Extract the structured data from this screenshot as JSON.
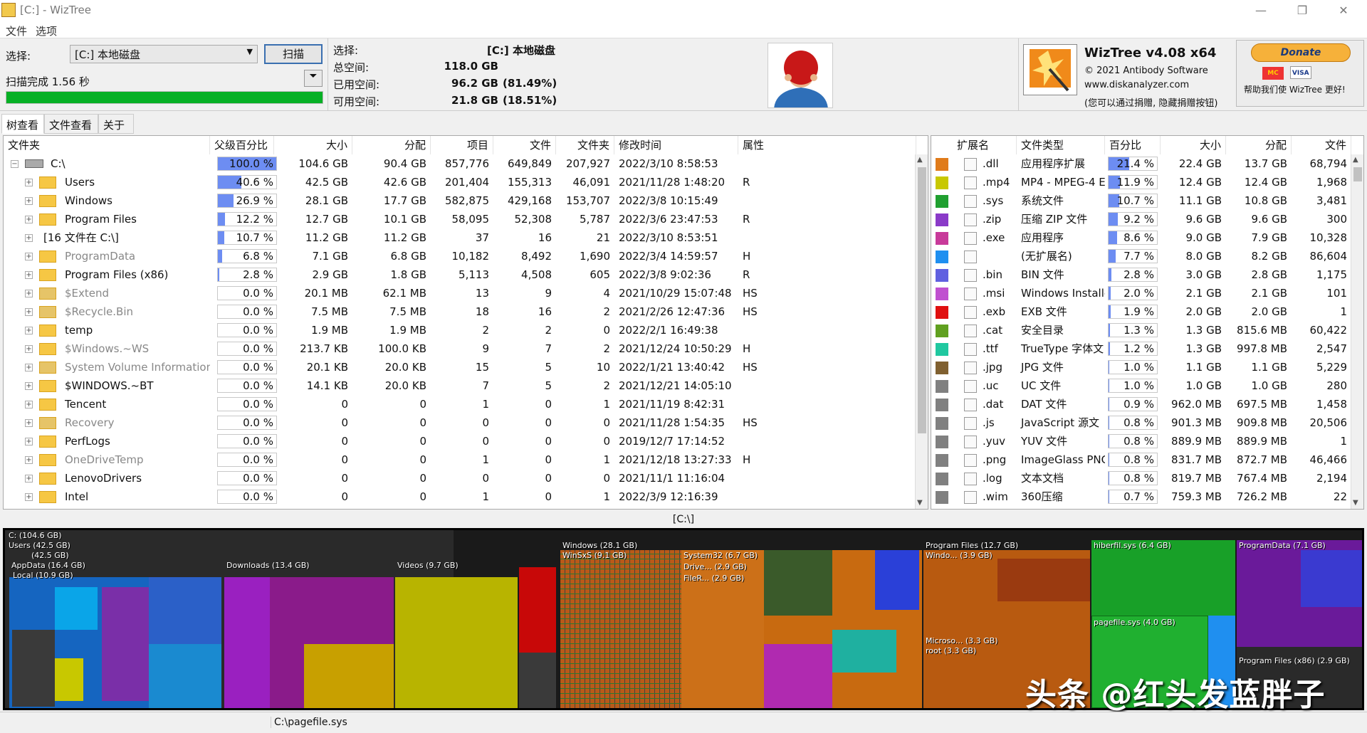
{
  "window": {
    "title": "[C:] - WizTree"
  },
  "menu": [
    "文件",
    "选项"
  ],
  "scan": {
    "select_label": "选择:",
    "drive": "[C:] 本地磁盘",
    "scan_button": "扫描",
    "status": "扫描完成 1.56 秒",
    "progress": 1.0
  },
  "info": {
    "select_label": "选择:",
    "select_value": "[C:]  本地磁盘",
    "total_label": "总空间:",
    "total_value": "118.0 GB",
    "used_label": "已用空间:",
    "used_value": "96.2 GB",
    "used_pct": "(81.49%)",
    "free_label": "可用空间:",
    "free_value": "21.8 GB",
    "free_pct": "(18.51%)"
  },
  "about": {
    "name": "WizTree v4.08 x64",
    "copyright": "© 2021 Antibody Software",
    "url": "www.diskanalyzer.com",
    "note": "(您可以通过捐赠, 隐藏捐赠按钮)"
  },
  "donate": {
    "button": "Donate",
    "card1": "MC",
    "card2": "VISA",
    "note": "帮助我们使 WizTree 更好!"
  },
  "tabs": [
    "树查看",
    "文件查看",
    "关于"
  ],
  "tree": {
    "columns": [
      "文件夹",
      "父级百分比",
      "大小",
      "分配",
      "项目",
      "文件",
      "文件夹",
      "修改时间",
      "属性"
    ],
    "rows": [
      {
        "name": "C:\\",
        "pct": 100.0,
        "pct_text": "100.0 %",
        "size": "104.6 GB",
        "alloc": "90.4 GB",
        "items": "857,776",
        "files": "649,849",
        "folders": "207,927",
        "modified": "2022/3/10 8:58:53",
        "attr": "",
        "kind": "drive"
      },
      {
        "name": "Users",
        "pct": 40.6,
        "pct_text": "40.6 %",
        "size": "42.5 GB",
        "alloc": "42.6 GB",
        "items": "201,404",
        "files": "155,313",
        "folders": "46,091",
        "modified": "2021/11/28 1:48:20",
        "attr": "R",
        "kind": "folder"
      },
      {
        "name": "Windows",
        "pct": 26.9,
        "pct_text": "26.9 %",
        "size": "28.1 GB",
        "alloc": "17.7 GB",
        "items": "582,875",
        "files": "429,168",
        "folders": "153,707",
        "modified": "2022/3/8 10:15:49",
        "attr": "",
        "kind": "folder"
      },
      {
        "name": "Program Files",
        "pct": 12.2,
        "pct_text": "12.2 %",
        "size": "12.7 GB",
        "alloc": "10.1 GB",
        "items": "58,095",
        "files": "52,308",
        "folders": "5,787",
        "modified": "2022/3/6 23:47:53",
        "attr": "R",
        "kind": "folder"
      },
      {
        "name": "[16 文件在 C:\\]",
        "pct": 10.7,
        "pct_text": "10.7 %",
        "size": "11.2 GB",
        "alloc": "11.2 GB",
        "items": "37",
        "files": "16",
        "folders": "21",
        "modified": "2022/3/10 8:53:51",
        "attr": "",
        "kind": "files"
      },
      {
        "name": "ProgramData",
        "pct": 6.8,
        "pct_text": "6.8 %",
        "size": "7.1 GB",
        "alloc": "6.8 GB",
        "items": "10,182",
        "files": "8,492",
        "folders": "1,690",
        "modified": "2022/3/4 14:59:57",
        "attr": "H",
        "kind": "hidden"
      },
      {
        "name": "Program Files (x86)",
        "pct": 2.8,
        "pct_text": "2.8 %",
        "size": "2.9 GB",
        "alloc": "1.8 GB",
        "items": "5,113",
        "files": "4,508",
        "folders": "605",
        "modified": "2022/3/8 9:02:36",
        "attr": "R",
        "kind": "folder"
      },
      {
        "name": "$Extend",
        "pct": 0.0,
        "pct_text": "0.0 %",
        "size": "20.1 MB",
        "alloc": "62.1 MB",
        "items": "13",
        "files": "9",
        "folders": "4",
        "modified": "2021/10/29 15:07:48",
        "attr": "HS",
        "kind": "system"
      },
      {
        "name": "$Recycle.Bin",
        "pct": 0.0,
        "pct_text": "0.0 %",
        "size": "7.5 MB",
        "alloc": "7.5 MB",
        "items": "18",
        "files": "16",
        "folders": "2",
        "modified": "2021/2/26 12:47:36",
        "attr": "HS",
        "kind": "system"
      },
      {
        "name": "temp",
        "pct": 0.0,
        "pct_text": "0.0 %",
        "size": "1.9 MB",
        "alloc": "1.9 MB",
        "items": "2",
        "files": "2",
        "folders": "0",
        "modified": "2022/2/1 16:49:38",
        "attr": "",
        "kind": "folder"
      },
      {
        "name": "$Windows.~WS",
        "pct": 0.0,
        "pct_text": "0.0 %",
        "size": "213.7 KB",
        "alloc": "100.0 KB",
        "items": "9",
        "files": "7",
        "folders": "2",
        "modified": "2021/12/24 10:50:29",
        "attr": "H",
        "kind": "hidden"
      },
      {
        "name": "System Volume Information",
        "pct": 0.0,
        "pct_text": "0.0 %",
        "size": "20.1 KB",
        "alloc": "20.0 KB",
        "items": "15",
        "files": "5",
        "folders": "10",
        "modified": "2022/1/21 13:40:42",
        "attr": "HS",
        "kind": "system"
      },
      {
        "name": "$WINDOWS.~BT",
        "pct": 0.0,
        "pct_text": "0.0 %",
        "size": "14.1 KB",
        "alloc": "20.0 KB",
        "items": "7",
        "files": "5",
        "folders": "2",
        "modified": "2021/12/21 14:05:10",
        "attr": "",
        "kind": "folder"
      },
      {
        "name": "Tencent",
        "pct": 0.0,
        "pct_text": "0.0 %",
        "size": "0",
        "alloc": "0",
        "items": "1",
        "files": "0",
        "folders": "1",
        "modified": "2021/11/19 8:42:31",
        "attr": "",
        "kind": "folder"
      },
      {
        "name": "Recovery",
        "pct": 0.0,
        "pct_text": "0.0 %",
        "size": "0",
        "alloc": "0",
        "items": "0",
        "files": "0",
        "folders": "0",
        "modified": "2021/11/28 1:54:35",
        "attr": "HS",
        "kind": "system"
      },
      {
        "name": "PerfLogs",
        "pct": 0.0,
        "pct_text": "0.0 %",
        "size": "0",
        "alloc": "0",
        "items": "0",
        "files": "0",
        "folders": "0",
        "modified": "2019/12/7 17:14:52",
        "attr": "",
        "kind": "folder"
      },
      {
        "name": "OneDriveTemp",
        "pct": 0.0,
        "pct_text": "0.0 %",
        "size": "0",
        "alloc": "0",
        "items": "1",
        "files": "0",
        "folders": "1",
        "modified": "2021/12/18 13:27:33",
        "attr": "H",
        "kind": "hidden"
      },
      {
        "name": "LenovoDrivers",
        "pct": 0.0,
        "pct_text": "0.0 %",
        "size": "0",
        "alloc": "0",
        "items": "0",
        "files": "0",
        "folders": "0",
        "modified": "2021/11/1 11:16:04",
        "attr": "",
        "kind": "folder"
      },
      {
        "name": "Intel",
        "pct": 0.0,
        "pct_text": "0.0 %",
        "size": "0",
        "alloc": "0",
        "items": "1",
        "files": "0",
        "folders": "1",
        "modified": "2022/3/9 12:16:39",
        "attr": "",
        "kind": "folder"
      }
    ]
  },
  "ext": {
    "columns": [
      "扩展名",
      "文件类型",
      "百分比",
      "大小",
      "分配",
      "文件"
    ],
    "rows": [
      {
        "color": "#e07b1a",
        "ext": ".dll",
        "type": "应用程序扩展",
        "pct": 21.4,
        "pct_text": "21.4 %",
        "size": "22.4 GB",
        "alloc": "13.7 GB",
        "files": "68,794"
      },
      {
        "color": "#c8c800",
        "ext": ".mp4",
        "type": "MP4 - MPEG-4 E",
        "pct": 11.9,
        "pct_text": "11.9 %",
        "size": "12.4 GB",
        "alloc": "12.4 GB",
        "files": "1,968"
      },
      {
        "color": "#20a030",
        "ext": ".sys",
        "type": "系统文件",
        "pct": 10.7,
        "pct_text": "10.7 %",
        "size": "11.1 GB",
        "alloc": "10.8 GB",
        "files": "3,481"
      },
      {
        "color": "#8a3ac8",
        "ext": ".zip",
        "type": "压缩 ZIP 文件",
        "pct": 9.2,
        "pct_text": "9.2 %",
        "size": "9.6 GB",
        "alloc": "9.6 GB",
        "files": "300"
      },
      {
        "color": "#c83a9a",
        "ext": ".exe",
        "type": "应用程序",
        "pct": 8.6,
        "pct_text": "8.6 %",
        "size": "9.0 GB",
        "alloc": "7.9 GB",
        "files": "10,328"
      },
      {
        "color": "#1f8ff0",
        "ext": "",
        "type": "(无扩展名)",
        "pct": 7.7,
        "pct_text": "7.7 %",
        "size": "8.0 GB",
        "alloc": "8.2 GB",
        "files": "86,604"
      },
      {
        "color": "#6060e0",
        "ext": ".bin",
        "type": "BIN 文件",
        "pct": 2.8,
        "pct_text": "2.8 %",
        "size": "3.0 GB",
        "alloc": "2.8 GB",
        "files": "1,175"
      },
      {
        "color": "#c050d0",
        "ext": ".msi",
        "type": "Windows Installe",
        "pct": 2.0,
        "pct_text": "2.0 %",
        "size": "2.1 GB",
        "alloc": "2.1 GB",
        "files": "101"
      },
      {
        "color": "#e01010",
        "ext": ".exb",
        "type": "EXB 文件",
        "pct": 1.9,
        "pct_text": "1.9 %",
        "size": "2.0 GB",
        "alloc": "2.0 GB",
        "files": "1"
      },
      {
        "color": "#60a020",
        "ext": ".cat",
        "type": "安全目录",
        "pct": 1.3,
        "pct_text": "1.3 %",
        "size": "1.3 GB",
        "alloc": "815.6 MB",
        "files": "60,422"
      },
      {
        "color": "#20c8a0",
        "ext": ".ttf",
        "type": "TrueType 字体文",
        "pct": 1.2,
        "pct_text": "1.2 %",
        "size": "1.3 GB",
        "alloc": "997.8 MB",
        "files": "2,547"
      },
      {
        "color": "#806030",
        "ext": ".jpg",
        "type": "JPG 文件",
        "pct": 1.0,
        "pct_text": "1.0 %",
        "size": "1.1 GB",
        "alloc": "1.1 GB",
        "files": "5,229"
      },
      {
        "color": "#808080",
        "ext": ".uc",
        "type": "UC 文件",
        "pct": 1.0,
        "pct_text": "1.0 %",
        "size": "1.0 GB",
        "alloc": "1.0 GB",
        "files": "280"
      },
      {
        "color": "#808080",
        "ext": ".dat",
        "type": "DAT 文件",
        "pct": 0.9,
        "pct_text": "0.9 %",
        "size": "962.0 MB",
        "alloc": "697.5 MB",
        "files": "1,458"
      },
      {
        "color": "#808080",
        "ext": ".js",
        "type": "JavaScript 源文",
        "pct": 0.8,
        "pct_text": "0.8 %",
        "size": "901.3 MB",
        "alloc": "909.8 MB",
        "files": "20,506"
      },
      {
        "color": "#808080",
        "ext": ".yuv",
        "type": "YUV 文件",
        "pct": 0.8,
        "pct_text": "0.8 %",
        "size": "889.9 MB",
        "alloc": "889.9 MB",
        "files": "1"
      },
      {
        "color": "#808080",
        "ext": ".png",
        "type": "ImageGlass PNG",
        "pct": 0.8,
        "pct_text": "0.8 %",
        "size": "831.7 MB",
        "alloc": "872.7 MB",
        "files": "46,466"
      },
      {
        "color": "#808080",
        "ext": ".log",
        "type": "文本文档",
        "pct": 0.8,
        "pct_text": "0.8 %",
        "size": "819.7 MB",
        "alloc": "767.4 MB",
        "files": "2,194"
      },
      {
        "color": "#808080",
        "ext": ".wim",
        "type": "360压缩",
        "pct": 0.7,
        "pct_text": "0.7 %",
        "size": "759.3 MB",
        "alloc": "726.2 MB",
        "files": "22"
      }
    ]
  },
  "treemap": {
    "path": "[C:\\]",
    "labels": {
      "root": "C: (104.6 GB)",
      "users": "Users (42.5 GB)",
      "users_sub": "(42.5 GB)",
      "appdata": "AppData (16.4 GB)",
      "local": "Local (10.9 GB)",
      "downloads": "Downloads (13.4 GB)",
      "videos": "Videos (9.7 GB)",
      "windows": "Windows (28.1 GB)",
      "winsxs": "WinSxS (9.1 GB)",
      "system32": "System32 (6.7 GB)",
      "drive": "Drive... (2.9 GB)",
      "filer": "FileR... (2.9 GB)",
      "programfiles": "Program Files (12.7 GB)",
      "windo": "Windo... (3.9 GB)",
      "microso": "Microso... (3.3 GB)",
      "root_sub": "root (3.3 GB)",
      "hiberfil": "hiberfil.sys (6.4 GB)",
      "pagefile": "pagefile.sys (4.0 GB)",
      "programdata": "ProgramData (7.1 GB)",
      "pfx86": "Program Files (x86) (2.9 GB)"
    }
  },
  "watermark": "头条 @红头发蓝胖子",
  "status": {
    "path": "C:\\pagefile.sys"
  }
}
